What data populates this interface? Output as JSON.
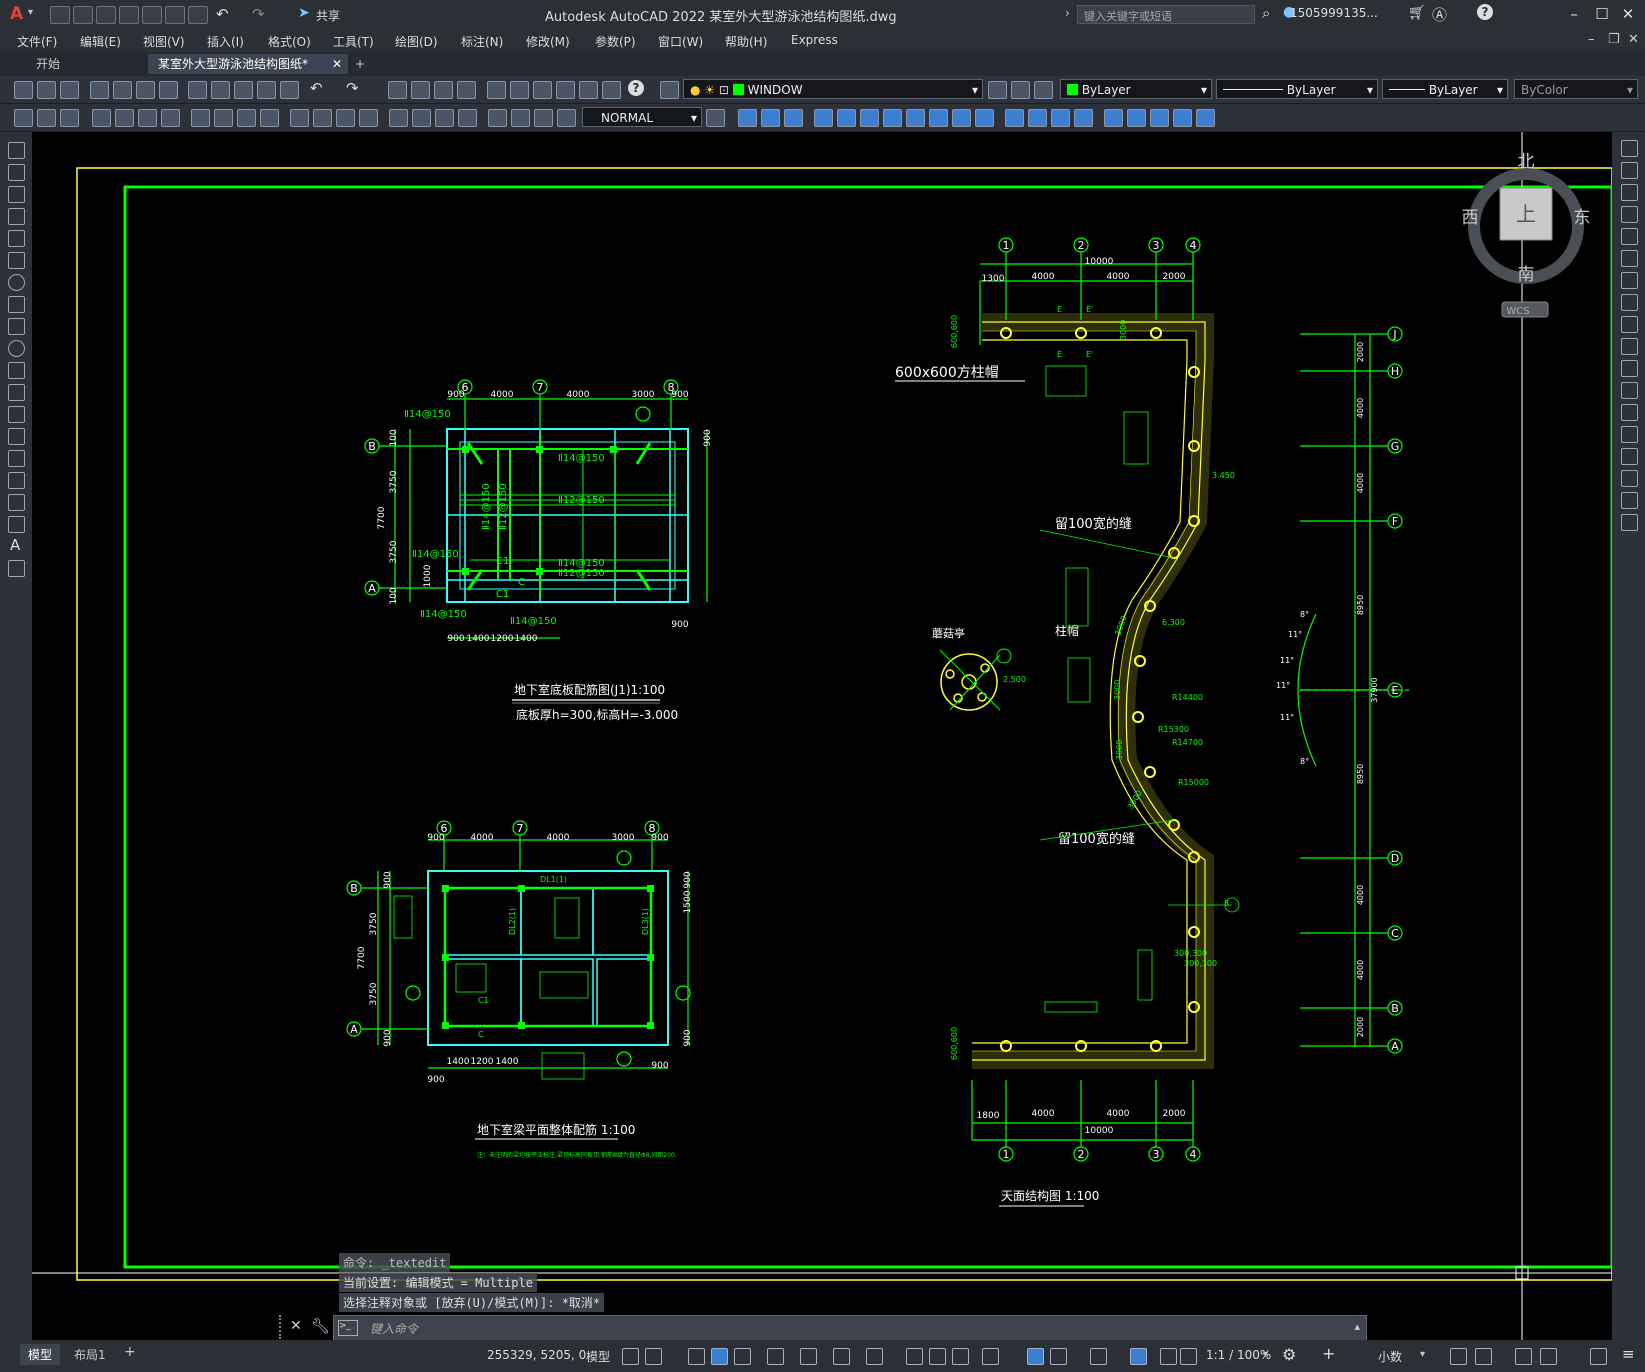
{
  "titlebar": {
    "app_logo": "A",
    "share_label": "共享",
    "title": "Autodesk AutoCAD 2022    某室外大型游泳池结构图纸.dwg",
    "search_placeholder": "键入关键字或短语",
    "user": "1505999135...",
    "help": "?"
  },
  "menu": [
    "文件(F)",
    "编辑(E)",
    "视图(V)",
    "插入(I)",
    "格式(O)",
    "工具(T)",
    "绘图(D)",
    "标注(N)",
    "修改(M)",
    "参数(P)",
    "窗口(W)",
    "帮助(H)",
    "Express"
  ],
  "tabs": {
    "start": "开始",
    "active": "某室外大型游泳池结构图纸*",
    "add": "+"
  },
  "toolbar1": {
    "layer": "WINDOW",
    "color": "ByLayer",
    "linetype": "ByLayer",
    "lineweight": "ByLayer",
    "plotstyle": "ByColor"
  },
  "toolbar2": {
    "style": "NORMAL"
  },
  "viewcube": {
    "north": "北",
    "south": "南",
    "west": "西",
    "east": "东",
    "top": "上",
    "wcs": "WCS"
  },
  "drawing": {
    "plan1": {
      "title": "地下室底板配筋图(J1)1:100",
      "subtitle": "底板厚h=300,标高H=-3.000",
      "axes_top": [
        "6",
        "7",
        "8"
      ],
      "axes_left": [
        "B",
        "A"
      ],
      "dims_top": [
        "900",
        "4000",
        "4000",
        "3000",
        "900"
      ],
      "dims_bottom": [
        "900",
        "1400",
        "1200",
        "1400"
      ],
      "dims_left": [
        "7700",
        "3750",
        "3750",
        "1000",
        "100",
        "100"
      ],
      "dims_right": [
        "900",
        "900"
      ],
      "rebar": [
        "Ⅱ14@150",
        "Ⅱ14@150",
        "Ⅱ14@150",
        "Ⅱ14@150",
        "Ⅱ12@150",
        "Ⅱ14@150",
        "Ⅱ12@150",
        "Ⅱ14@150",
        "Ⅱ12@150",
        "Ⅱ14@150",
        "Ⅱ14@150"
      ],
      "labels": [
        "C1",
        "C1",
        "C"
      ]
    },
    "plan2": {
      "title": "地下室梁平面整体配筋 1:100",
      "note": "注：未注明的梁均按平法标注,梁顶标高同板顶,钢筋Ⅲ级为直径Φ8,间距200.",
      "axes_top": [
        "6",
        "7",
        "8"
      ],
      "axes_left": [
        "B",
        "A"
      ],
      "dims_top": [
        "900",
        "4000",
        "4000",
        "3000",
        "900"
      ],
      "dims_bottom": [
        "900",
        "1400",
        "1200",
        "1400",
        "900"
      ],
      "dims_left": [
        "7700",
        "3750",
        "3750",
        "900",
        "900"
      ],
      "dims_right": [
        "900",
        "1500",
        "900"
      ],
      "labels": [
        "DL1(1)",
        "DL2(1)",
        "DL3(1)",
        "C1",
        "C"
      ]
    },
    "plan3": {
      "title": "天面结构图 1:100",
      "axes_top": [
        "1",
        "2",
        "3",
        "4"
      ],
      "axes_bottom": [
        "1",
        "2",
        "3",
        "4"
      ],
      "axes_right": [
        "J",
        "H",
        "G",
        "F",
        "E",
        "D",
        "C",
        "B",
        "A"
      ],
      "dims_top_total": "10000",
      "dims_top": [
        "1300",
        "4000",
        "4000",
        "2000"
      ],
      "dims_bottom_total": "10000",
      "dims_bottom": [
        "1800",
        "4000",
        "4000",
        "2000"
      ],
      "dims_right": [
        "2000",
        "4000",
        "4000",
        "8950",
        "37900",
        "8950",
        "4000",
        "4000",
        "2000"
      ],
      "notes": [
        "600x600方柱帽",
        "留100宽的缝",
        "柱帽",
        "留100宽的缝",
        "蘑菇亭"
      ],
      "radii": [
        "R14400",
        "R15300",
        "R14700",
        "R15000"
      ],
      "elev": [
        "3.450",
        "6.300",
        "2.500"
      ],
      "angles": [
        "8°",
        "11°",
        "11°",
        "11°",
        "11°",
        "8°"
      ],
      "marks": [
        "E",
        "E'",
        "E",
        "E'",
        "8"
      ],
      "small_dims": [
        "600,600",
        "600,600",
        "300,300",
        "300,300",
        "3000",
        "3000",
        "3000",
        "3000",
        "3000"
      ]
    }
  },
  "command": {
    "line1": "命令: _textedit",
    "line2": "当前设置: 编辑模式 = Multiple",
    "line3": "选择注释对象或 [放弃(U)/模式(M)]: *取消*",
    "placeholder": "键入命令"
  },
  "status": {
    "model_tab": "模型",
    "layout_tab": "布局1",
    "add": "+",
    "coords": "255329, 5205, 0",
    "model": "模型",
    "scale": "1:1 / 100%",
    "units": "小数"
  },
  "colors": {
    "accent": "#00ff00",
    "yellow": "#ffff33",
    "cyan": "#33ffff",
    "canvas": "#000000"
  }
}
